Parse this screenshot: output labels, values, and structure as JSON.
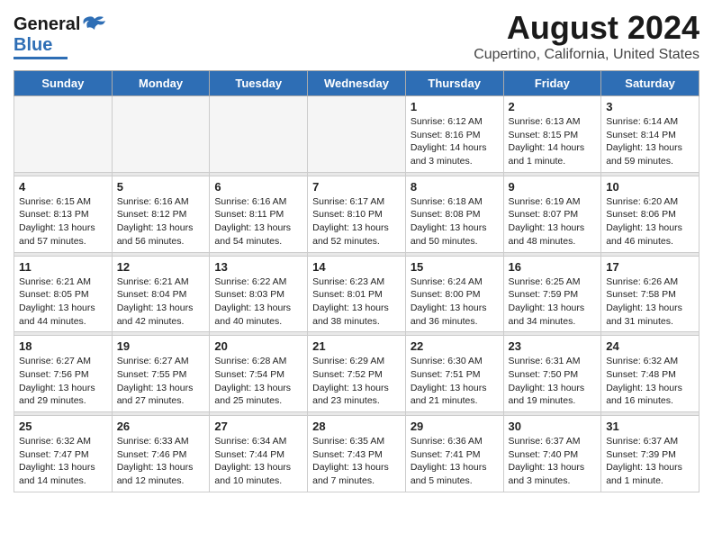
{
  "logo": {
    "line1": "General",
    "line2": "Blue"
  },
  "title": "August 2024",
  "subtitle": "Cupertino, California, United States",
  "weekdays": [
    "Sunday",
    "Monday",
    "Tuesday",
    "Wednesday",
    "Thursday",
    "Friday",
    "Saturday"
  ],
  "weeks": [
    [
      {
        "day": "",
        "info": ""
      },
      {
        "day": "",
        "info": ""
      },
      {
        "day": "",
        "info": ""
      },
      {
        "day": "",
        "info": ""
      },
      {
        "day": "1",
        "info": "Sunrise: 6:12 AM\nSunset: 8:16 PM\nDaylight: 14 hours\nand 3 minutes."
      },
      {
        "day": "2",
        "info": "Sunrise: 6:13 AM\nSunset: 8:15 PM\nDaylight: 14 hours\nand 1 minute."
      },
      {
        "day": "3",
        "info": "Sunrise: 6:14 AM\nSunset: 8:14 PM\nDaylight: 13 hours\nand 59 minutes."
      }
    ],
    [
      {
        "day": "4",
        "info": "Sunrise: 6:15 AM\nSunset: 8:13 PM\nDaylight: 13 hours\nand 57 minutes."
      },
      {
        "day": "5",
        "info": "Sunrise: 6:16 AM\nSunset: 8:12 PM\nDaylight: 13 hours\nand 56 minutes."
      },
      {
        "day": "6",
        "info": "Sunrise: 6:16 AM\nSunset: 8:11 PM\nDaylight: 13 hours\nand 54 minutes."
      },
      {
        "day": "7",
        "info": "Sunrise: 6:17 AM\nSunset: 8:10 PM\nDaylight: 13 hours\nand 52 minutes."
      },
      {
        "day": "8",
        "info": "Sunrise: 6:18 AM\nSunset: 8:08 PM\nDaylight: 13 hours\nand 50 minutes."
      },
      {
        "day": "9",
        "info": "Sunrise: 6:19 AM\nSunset: 8:07 PM\nDaylight: 13 hours\nand 48 minutes."
      },
      {
        "day": "10",
        "info": "Sunrise: 6:20 AM\nSunset: 8:06 PM\nDaylight: 13 hours\nand 46 minutes."
      }
    ],
    [
      {
        "day": "11",
        "info": "Sunrise: 6:21 AM\nSunset: 8:05 PM\nDaylight: 13 hours\nand 44 minutes."
      },
      {
        "day": "12",
        "info": "Sunrise: 6:21 AM\nSunset: 8:04 PM\nDaylight: 13 hours\nand 42 minutes."
      },
      {
        "day": "13",
        "info": "Sunrise: 6:22 AM\nSunset: 8:03 PM\nDaylight: 13 hours\nand 40 minutes."
      },
      {
        "day": "14",
        "info": "Sunrise: 6:23 AM\nSunset: 8:01 PM\nDaylight: 13 hours\nand 38 minutes."
      },
      {
        "day": "15",
        "info": "Sunrise: 6:24 AM\nSunset: 8:00 PM\nDaylight: 13 hours\nand 36 minutes."
      },
      {
        "day": "16",
        "info": "Sunrise: 6:25 AM\nSunset: 7:59 PM\nDaylight: 13 hours\nand 34 minutes."
      },
      {
        "day": "17",
        "info": "Sunrise: 6:26 AM\nSunset: 7:58 PM\nDaylight: 13 hours\nand 31 minutes."
      }
    ],
    [
      {
        "day": "18",
        "info": "Sunrise: 6:27 AM\nSunset: 7:56 PM\nDaylight: 13 hours\nand 29 minutes."
      },
      {
        "day": "19",
        "info": "Sunrise: 6:27 AM\nSunset: 7:55 PM\nDaylight: 13 hours\nand 27 minutes."
      },
      {
        "day": "20",
        "info": "Sunrise: 6:28 AM\nSunset: 7:54 PM\nDaylight: 13 hours\nand 25 minutes."
      },
      {
        "day": "21",
        "info": "Sunrise: 6:29 AM\nSunset: 7:52 PM\nDaylight: 13 hours\nand 23 minutes."
      },
      {
        "day": "22",
        "info": "Sunrise: 6:30 AM\nSunset: 7:51 PM\nDaylight: 13 hours\nand 21 minutes."
      },
      {
        "day": "23",
        "info": "Sunrise: 6:31 AM\nSunset: 7:50 PM\nDaylight: 13 hours\nand 19 minutes."
      },
      {
        "day": "24",
        "info": "Sunrise: 6:32 AM\nSunset: 7:48 PM\nDaylight: 13 hours\nand 16 minutes."
      }
    ],
    [
      {
        "day": "25",
        "info": "Sunrise: 6:32 AM\nSunset: 7:47 PM\nDaylight: 13 hours\nand 14 minutes."
      },
      {
        "day": "26",
        "info": "Sunrise: 6:33 AM\nSunset: 7:46 PM\nDaylight: 13 hours\nand 12 minutes."
      },
      {
        "day": "27",
        "info": "Sunrise: 6:34 AM\nSunset: 7:44 PM\nDaylight: 13 hours\nand 10 minutes."
      },
      {
        "day": "28",
        "info": "Sunrise: 6:35 AM\nSunset: 7:43 PM\nDaylight: 13 hours\nand 7 minutes."
      },
      {
        "day": "29",
        "info": "Sunrise: 6:36 AM\nSunset: 7:41 PM\nDaylight: 13 hours\nand 5 minutes."
      },
      {
        "day": "30",
        "info": "Sunrise: 6:37 AM\nSunset: 7:40 PM\nDaylight: 13 hours\nand 3 minutes."
      },
      {
        "day": "31",
        "info": "Sunrise: 6:37 AM\nSunset: 7:39 PM\nDaylight: 13 hours\nand 1 minute."
      }
    ]
  ]
}
